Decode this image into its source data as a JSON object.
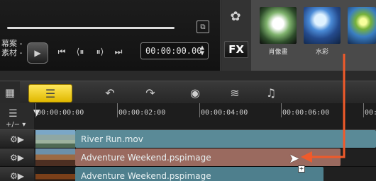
{
  "player": {
    "left_label_line1": "幕案 -",
    "left_label_line2": "素材 -",
    "timecode": "00:00:00.00",
    "fit_icon": "fit-window-icon",
    "play_icon": "play-icon",
    "transport_icons": [
      "skip-to-start-icon",
      "step-back-icon",
      "step-forward-icon",
      "skip-to-end-icon"
    ]
  },
  "library": {
    "fx_label": "FX",
    "gear_icon": "gear-icon",
    "items": [
      {
        "label": "肖像畫"
      },
      {
        "label": "水彩"
      },
      {
        "label": ""
      }
    ]
  },
  "toolbar": {
    "icons": [
      "storyboard-icon",
      "timeline-icon",
      "undo-icon",
      "redo-icon",
      "record-capture-icon",
      "audio-mixer-icon",
      "auto-music-icon"
    ]
  },
  "ruler": {
    "labels": [
      "00:00:00:00",
      "00:00:02:00",
      "00:00:04:00",
      "00:00:06:00",
      "00:"
    ]
  },
  "tracks": [
    {
      "name": "River Run.mov"
    },
    {
      "name": "Adventure Weekend.pspimage"
    },
    {
      "name": "Adventure Weekend.pspimage"
    }
  ],
  "colors": {
    "accent": "#f05a2a",
    "timeline_button": "#f2cf1e",
    "clip_video": "#5a8a97",
    "clip_overlay": "#9a6a5f"
  }
}
